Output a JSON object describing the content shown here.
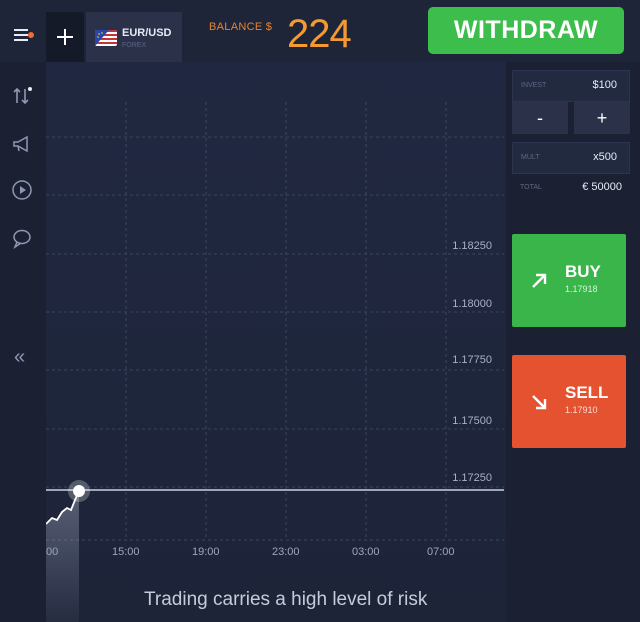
{
  "header": {
    "asset": {
      "name": "EUR/USD",
      "type": "FOREX"
    },
    "balance": {
      "label": "BALANCE $",
      "value": "224"
    },
    "withdraw_label": "WITHDRAW"
  },
  "sidebar": {
    "icons": [
      "sort-arrows-icon",
      "megaphone-icon",
      "play-icon",
      "chat-icon"
    ],
    "collapse_label": "«"
  },
  "chart": {
    "price_labels": [
      "1.18250",
      "1.18000",
      "1.17750",
      "1.17500",
      "1.17250"
    ],
    "time_labels": [
      "00",
      "15:00",
      "19:00",
      "23:00",
      "03:00",
      "07:00"
    ],
    "risk_note": "Trading carries a high level of risk"
  },
  "trade": {
    "invest": {
      "label": "INVEST",
      "value": "$100"
    },
    "minus_label": "-",
    "plus_label": "+",
    "multiplier": {
      "label": "MULT",
      "value": "x500"
    },
    "total": {
      "label": "TOTAL",
      "value": "€ 50000"
    },
    "buy": {
      "label": "BUY",
      "price": "1.17918"
    },
    "sell": {
      "label": "SELL",
      "price": "1.17910"
    }
  },
  "colors": {
    "accent_green": "#3ab54a",
    "accent_red": "#e5522f",
    "balance_orange": "#f59a32"
  }
}
